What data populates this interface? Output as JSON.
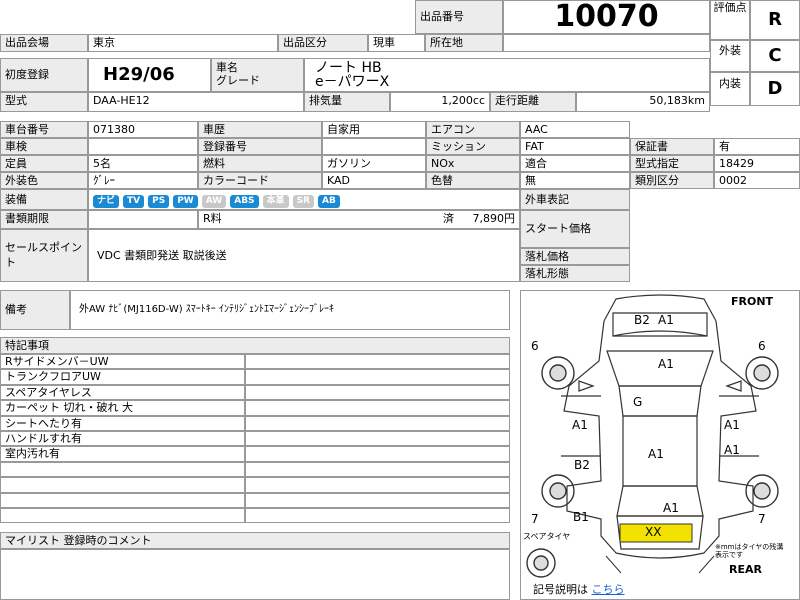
{
  "header": {
    "lot_label": "出品番号",
    "lot_number": "10070"
  },
  "grades": {
    "overall_label": "評価点",
    "overall": "R",
    "exterior_label": "外装",
    "exterior": "C",
    "interior_label": "内装",
    "interior": "D"
  },
  "row1": {
    "venue_label": "出品会場",
    "venue": "東京",
    "category_label": "出品区分",
    "category": "現車",
    "location_label": "所在地",
    "location": ""
  },
  "reg": {
    "first_reg_label": "初度登録",
    "first_reg": "H29/06",
    "car_name_label": "車名",
    "grade_label": "グレード",
    "car_name": "ノート HB",
    "grade": "e－パワーX"
  },
  "model": {
    "model_label": "型式",
    "model": "DAA-HE12",
    "displacement_label": "排気量",
    "displacement": "1,200cc",
    "mileage_label": "走行距離",
    "mileage": "50,183km"
  },
  "specs": {
    "chassis_label": "車台番号",
    "chassis": "071380",
    "history_label": "車歴",
    "history": "自家用",
    "aircon_label": "エアコン",
    "aircon": "AAC",
    "inspection_label": "車検",
    "inspection": "",
    "regno_label": "登録番号",
    "regno": "",
    "mission_label": "ミッション",
    "mission": "FAT",
    "warranty_label": "保証書",
    "warranty": "有",
    "capacity_label": "定員",
    "capacity": "5名",
    "fuel_label": "燃料",
    "fuel": "ガソリン",
    "nox_label": "NOx",
    "nox": "適合",
    "type_designation_label": "型式指定",
    "type_designation": "18429",
    "color_label": "外装色",
    "color": "ｸﾞﾚｰ",
    "color_code_label": "カラーコード",
    "color_code": "KAD",
    "repaint_label": "色替",
    "repaint": "無",
    "class_label": "類別区分",
    "class": "0002"
  },
  "equipment": {
    "label": "装備",
    "items": [
      {
        "label": "ナビ",
        "on": true
      },
      {
        "label": "TV",
        "on": true
      },
      {
        "label": "PS",
        "on": true
      },
      {
        "label": "PW",
        "on": true
      },
      {
        "label": "AW",
        "on": false
      },
      {
        "label": "ABS",
        "on": true
      },
      {
        "label": "本革",
        "on": false
      },
      {
        "label": "SR",
        "on": false
      },
      {
        "label": "AB",
        "on": true
      }
    ],
    "exterior_notation_label": "外車表記"
  },
  "docs": {
    "deadline_label": "書類期限",
    "deadline": "",
    "recycle_label": "R料",
    "recycle_status": "済",
    "recycle_amount": "7,890円",
    "start_price_label": "スタート価格",
    "start_price": ""
  },
  "sales": {
    "label": "セールスポイント",
    "text": "VDC 書類即発送 取説後送",
    "winning_price_label": "落札価格",
    "winning_price": "",
    "winning_form_label": "落札形態",
    "winning_form": ""
  },
  "remarks": {
    "label": "備考",
    "text": "外AW ﾅﾋﾞ(MJ116D-W) ｽﾏｰﾄｷｰ ｲﾝﾃﾘｼﾞｪﾝﾄｴﾏｰｼﾞｪﾝｼｰﾌﾞﾚｰｷ"
  },
  "special_notes": {
    "label": "特記事項",
    "rows": [
      "Rサイドメンバ－UW",
      "トランクフロアUW",
      "スペアタイヤレス",
      "カーペット 切れ・破れ 大",
      "シートへたり有",
      "ハンドルすれ有",
      "室内汚れ有",
      "",
      "",
      "",
      ""
    ]
  },
  "mylist": {
    "label": "マイリスト 登録時のコメント"
  },
  "diagram": {
    "front": "FRONT",
    "rear": "REAR",
    "spare_tire": "スペアタイヤ",
    "note": "※mmはタイヤの残溝表示です",
    "legend_label": "記号説明は",
    "legend_link": "こちら",
    "marks": {
      "b2": "B2",
      "a1_roof": "A1",
      "a1_hood": "A1",
      "g": "G",
      "a1_l_front": "A1",
      "a1_r_front": "A1",
      "a1_center": "A1",
      "b2_l": "B2",
      "a1_r_rear": "A1",
      "a1_trunk": "A1",
      "b1": "B1",
      "xx": "XX",
      "tire_fl": "6",
      "tire_fr": "6",
      "tire_rl": "7",
      "tire_rr": "7"
    }
  }
}
